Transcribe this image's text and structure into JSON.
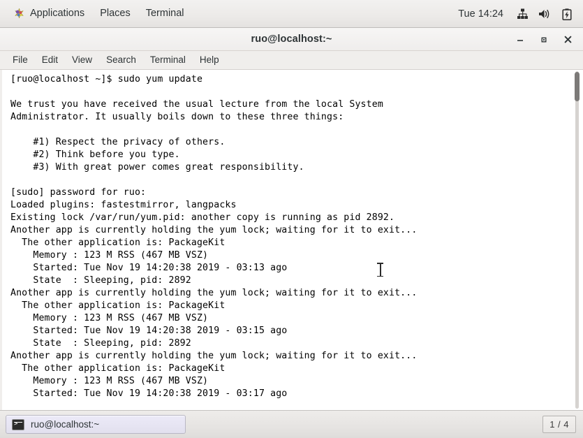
{
  "top_panel": {
    "menus": [
      {
        "label": "Applications",
        "icon": "fedora-starburst-icon"
      },
      {
        "label": "Places",
        "icon": null
      },
      {
        "label": "Terminal",
        "icon": null
      }
    ],
    "clock": "Tue 14:24",
    "tray": [
      {
        "name": "network-icon",
        "glyph": "network"
      },
      {
        "name": "volume-icon",
        "glyph": "volume"
      },
      {
        "name": "battery-icon",
        "glyph": "battery"
      }
    ]
  },
  "window": {
    "title": "ruo@localhost:~",
    "controls": {
      "minimize": "–",
      "maximize": "■",
      "close": "✕"
    },
    "menubar": [
      "File",
      "Edit",
      "View",
      "Search",
      "Terminal",
      "Help"
    ]
  },
  "terminal": {
    "prompt": "[ruo@localhost ~]$",
    "command": "sudo yum update",
    "content": "[ruo@localhost ~]$ sudo yum update\n\nWe trust you have received the usual lecture from the local System\nAdministrator. It usually boils down to these three things:\n\n    #1) Respect the privacy of others.\n    #2) Think before you type.\n    #3) With great power comes great responsibility.\n\n[sudo] password for ruo:\nLoaded plugins: fastestmirror, langpacks\nExisting lock /var/run/yum.pid: another copy is running as pid 2892.\nAnother app is currently holding the yum lock; waiting for it to exit...\n  The other application is: PackageKit\n    Memory : 123 M RSS (467 MB VSZ)\n    Started: Tue Nov 19 14:20:38 2019 - 03:13 ago\n    State  : Sleeping, pid: 2892\nAnother app is currently holding the yum lock; waiting for it to exit...\n  The other application is: PackageKit\n    Memory : 123 M RSS (467 MB VSZ)\n    Started: Tue Nov 19 14:20:38 2019 - 03:15 ago\n    State  : Sleeping, pid: 2892\nAnother app is currently holding the yum lock; waiting for it to exit...\n  The other application is: PackageKit\n    Memory : 123 M RSS (467 MB VSZ)\n    Started: Tue Nov 19 14:20:38 2019 - 03:17 ago",
    "lines": [
      "[ruo@localhost ~]$ sudo yum update",
      "",
      "We trust you have received the usual lecture from the local System",
      "Administrator. It usually boils down to these three things:",
      "",
      "    #1) Respect the privacy of others.",
      "    #2) Think before you type.",
      "    #3) With great power comes great responsibility.",
      "",
      "[sudo] password for ruo:",
      "Loaded plugins: fastestmirror, langpacks",
      "Existing lock /var/run/yum.pid: another copy is running as pid 2892.",
      "Another app is currently holding the yum lock; waiting for it to exit...",
      "  The other application is: PackageKit",
      "    Memory : 123 M RSS (467 MB VSZ)",
      "    Started: Tue Nov 19 14:20:38 2019 - 03:13 ago",
      "    State  : Sleeping, pid: 2892",
      "Another app is currently holding the yum lock; waiting for it to exit...",
      "  The other application is: PackageKit",
      "    Memory : 123 M RSS (467 MB VSZ)",
      "    Started: Tue Nov 19 14:20:38 2019 - 03:15 ago",
      "    State  : Sleeping, pid: 2892",
      "Another app is currently holding the yum lock; waiting for it to exit...",
      "  The other application is: PackageKit",
      "    Memory : 123 M RSS (467 MB VSZ)",
      "    Started: Tue Nov 19 14:20:38 2019 - 03:17 ago"
    ],
    "background": "#ffffff",
    "foreground": "#000000"
  },
  "bottom_panel": {
    "task_button_label": "ruo@localhost:~",
    "task_button_icon": "terminal-icon",
    "workspace": "1 / 4"
  }
}
